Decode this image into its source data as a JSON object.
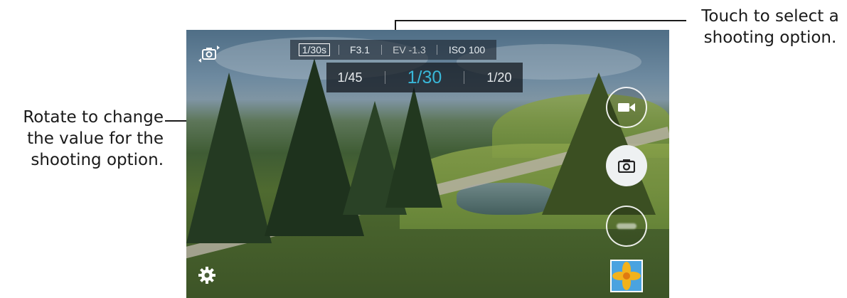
{
  "callouts": {
    "top_right": "Touch to select a shooting option.",
    "left": "Rotate to change the value for the shooting option."
  },
  "settings_bar": {
    "shutter": "1/30s",
    "aperture": "F3.1",
    "ev": "EV -1.3",
    "iso": "ISO 100"
  },
  "dial": {
    "prev": "1/45",
    "current": "1/30",
    "next": "1/20"
  },
  "icons": {
    "switch_camera": "switch-camera-icon",
    "settings": "gear-icon",
    "record_video": "video-camera-icon",
    "take_photo": "camera-icon",
    "mode": "mode-icon",
    "gallery": "gallery-thumbnail"
  },
  "colors": {
    "accent": "#39b7d8",
    "text": "#1a1a1a"
  }
}
